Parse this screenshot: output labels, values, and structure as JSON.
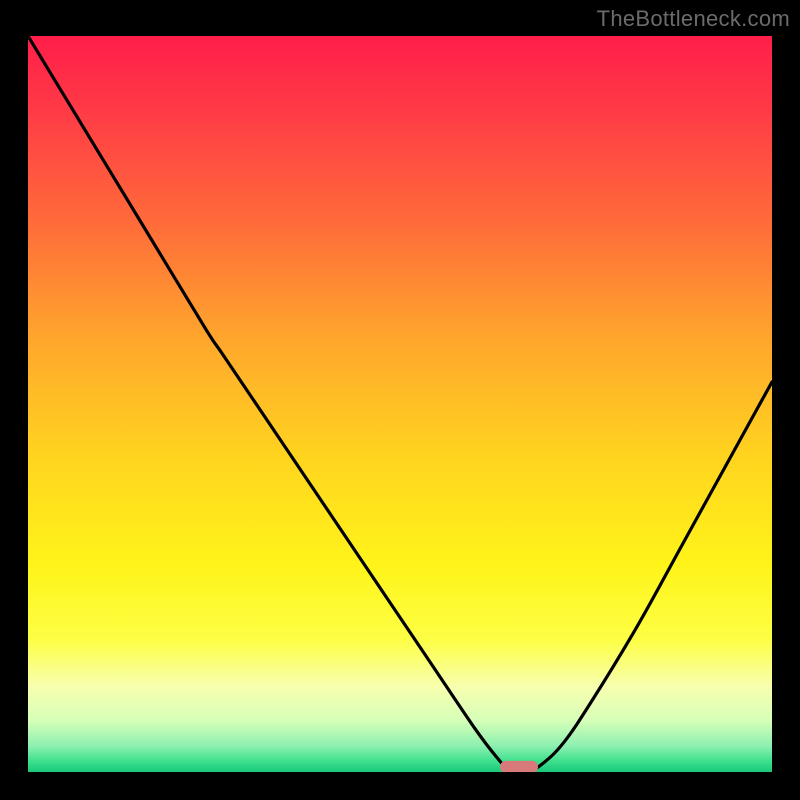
{
  "watermark": "TheBottleneck.com",
  "chart_data": {
    "type": "line",
    "title": "",
    "xlabel": "",
    "ylabel": "",
    "xlim": [
      0,
      100
    ],
    "ylim": [
      0,
      100
    ],
    "series": [
      {
        "name": "bottleneck-curve",
        "x": [
          0,
          6,
          12,
          18,
          24,
          26,
          30,
          36,
          42,
          48,
          54,
          60,
          63,
          65,
          67,
          69,
          72,
          76,
          82,
          88,
          94,
          100
        ],
        "y": [
          100,
          90,
          80,
          70,
          60,
          57,
          51,
          42,
          33,
          24,
          15,
          6,
          2,
          0,
          0,
          1,
          4,
          10,
          20,
          31,
          42,
          53
        ]
      }
    ],
    "marker": {
      "name": "optimal-zone",
      "x": 66,
      "y": 0.7,
      "color": "#d97a7a"
    },
    "background_gradient": {
      "stops": [
        {
          "pos": 0.0,
          "color": "#ff1e4a"
        },
        {
          "pos": 0.1,
          "color": "#ff3a46"
        },
        {
          "pos": 0.25,
          "color": "#ff6a3a"
        },
        {
          "pos": 0.42,
          "color": "#ffa92c"
        },
        {
          "pos": 0.58,
          "color": "#ffd61e"
        },
        {
          "pos": 0.72,
          "color": "#fff41a"
        },
        {
          "pos": 0.82,
          "color": "#fdff45"
        },
        {
          "pos": 0.885,
          "color": "#f7ffb0"
        },
        {
          "pos": 0.93,
          "color": "#d6ffb8"
        },
        {
          "pos": 0.965,
          "color": "#8cf0b0"
        },
        {
          "pos": 0.985,
          "color": "#3fe08e"
        },
        {
          "pos": 1.0,
          "color": "#17c97a"
        }
      ]
    }
  }
}
